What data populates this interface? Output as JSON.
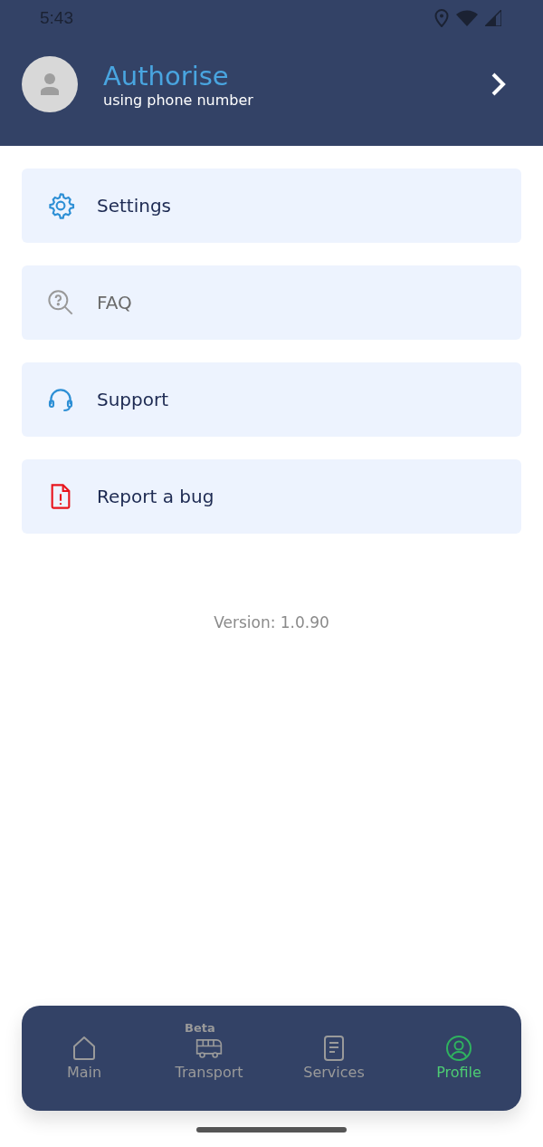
{
  "status_bar": {
    "time": "5:43"
  },
  "header": {
    "title": "Authorise",
    "subtitle": "using phone number"
  },
  "menu": [
    {
      "kind": "settings",
      "label": "Settings",
      "disabled": false
    },
    {
      "kind": "faq",
      "label": "FAQ",
      "disabled": true
    },
    {
      "kind": "support",
      "label": "Support",
      "disabled": false
    },
    {
      "kind": "bug",
      "label": "Report a bug",
      "disabled": false
    }
  ],
  "version": "Version: 1.0.90",
  "nav": [
    {
      "kind": "home",
      "label": "Main",
      "selected": false
    },
    {
      "kind": "bus",
      "label": "Transport",
      "selected": false,
      "badge": "Beta"
    },
    {
      "kind": "document",
      "label": "Services",
      "selected": false
    },
    {
      "kind": "profile",
      "label": "Profile",
      "selected": true
    }
  ]
}
